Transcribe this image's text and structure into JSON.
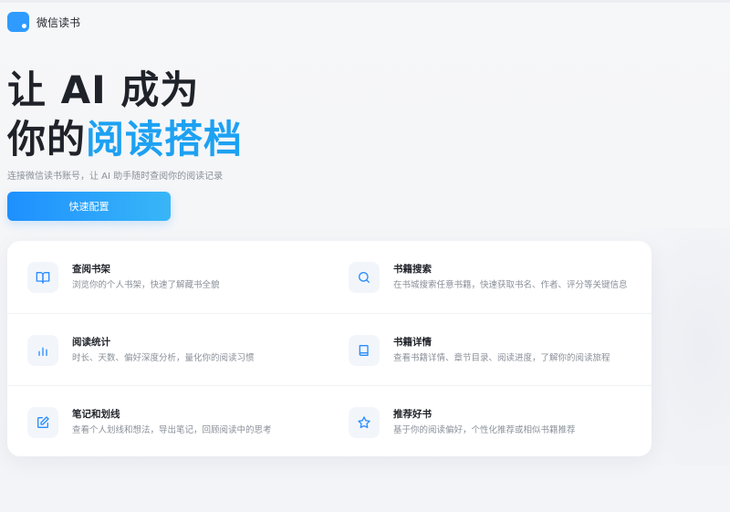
{
  "header": {
    "brand": "微信读书",
    "logo_icon": "chat-bubble-logo-icon"
  },
  "hero": {
    "line1": "让 AI 成为",
    "line2_prefix": "你的",
    "line2_accent": "阅读搭档",
    "subtitle": "连接微信读书账号，让 AI 助手随时查阅你的阅读记录",
    "cta_label": "快速配置"
  },
  "colors": {
    "accent": "#1da1f2",
    "cta_start": "#1e90ff",
    "cta_end": "#38b6f7",
    "icon_stroke": "#2a8cff"
  },
  "features": [
    {
      "title": "查阅书架",
      "desc": "浏览你的个人书架，快速了解藏书全貌",
      "icon": "open-book-icon"
    },
    {
      "title": "书籍搜索",
      "desc": "在书城搜索任意书籍，快速获取书名、作者、评分等关键信息",
      "icon": "search-icon"
    },
    {
      "title": "阅读统计",
      "desc": "时长、天数、偏好深度分析，量化你的阅读习惯",
      "icon": "bar-chart-icon"
    },
    {
      "title": "书籍详情",
      "desc": "查看书籍详情、章节目录、阅读进度，了解你的阅读旅程",
      "icon": "book-icon"
    },
    {
      "title": "笔记和划线",
      "desc": "查看个人划线和想法，导出笔记，回顾阅读中的思考",
      "icon": "edit-note-icon"
    },
    {
      "title": "推荐好书",
      "desc": "基于你的阅读偏好，个性化推荐或相似书籍推荐",
      "icon": "star-icon"
    }
  ]
}
